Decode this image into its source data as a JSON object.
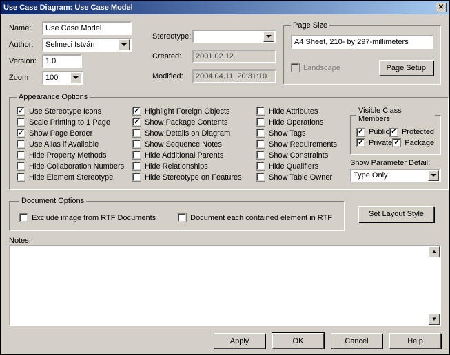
{
  "title": "Use Case Diagram: Use Case Model",
  "labels": {
    "name": "Name:",
    "author": "Author:",
    "version": "Version:",
    "zoom": "Zoom",
    "stereotype": "Stereotype:",
    "created": "Created:",
    "modified": "Modified:",
    "notes": "Notes:"
  },
  "fields": {
    "name": "Use Case Model",
    "author": "Selmeci István",
    "version": "1.0",
    "zoom": "100",
    "stereotype": "",
    "created": "2001.02.12.",
    "modified": "2004.04.11. 20:31:10"
  },
  "page_size": {
    "legend": "Page Size",
    "value": "A4 Sheet, 210- by 297-millimeters",
    "landscape_label": "Landscape",
    "page_setup_label": "Page Setup"
  },
  "appearance": {
    "legend": "Appearance Options",
    "col1": [
      {
        "label": "Use Stereotype Icons",
        "checked": true
      },
      {
        "label": "Scale Printing to 1 Page",
        "checked": false
      },
      {
        "label": "Show Page Border",
        "checked": true
      },
      {
        "label": "Use Alias if Available",
        "checked": false
      },
      {
        "label": "Hide Property Methods",
        "checked": false
      },
      {
        "label": "Hide Collaboration Numbers",
        "checked": false
      },
      {
        "label": "Hide Element Stereotype",
        "checked": false
      }
    ],
    "col2": [
      {
        "label": "Highlight Foreign Objects",
        "checked": true
      },
      {
        "label": "Show Package Contents",
        "checked": true
      },
      {
        "label": "Show Details on Diagram",
        "checked": false
      },
      {
        "label": "Show Sequence Notes",
        "checked": false
      },
      {
        "label": "Hide Additional Parents",
        "checked": false
      },
      {
        "label": "Hide Relationships",
        "checked": false
      },
      {
        "label": "Hide Stereotype on Features",
        "checked": false
      }
    ],
    "col3": [
      {
        "label": "Hide Attributes",
        "checked": false
      },
      {
        "label": "Hide Operations",
        "checked": false
      },
      {
        "label": "Show Tags",
        "checked": false
      },
      {
        "label": "Show Requirements",
        "checked": false
      },
      {
        "label": "Show Constraints",
        "checked": false
      },
      {
        "label": "Hide Qualifiers",
        "checked": false
      },
      {
        "label": "Show Table Owner",
        "checked": false
      }
    ],
    "visible_members": {
      "legend": "Visible Class Members",
      "items": [
        {
          "label": "Public",
          "checked": true
        },
        {
          "label": "Protected",
          "checked": true
        },
        {
          "label": "Private",
          "checked": true
        },
        {
          "label": "Package",
          "checked": true
        }
      ]
    },
    "show_parameter_label": "Show Parameter Detail:",
    "show_parameter_value": "Type Only"
  },
  "document": {
    "legend": "Document Options",
    "exclude_label": "Exclude image from RTF Documents",
    "each_label": "Document each contained element in RTF",
    "set_layout_label": "Set Layout Style"
  },
  "footer": {
    "apply": "Apply",
    "ok": "OK",
    "cancel": "Cancel",
    "help": "Help"
  }
}
